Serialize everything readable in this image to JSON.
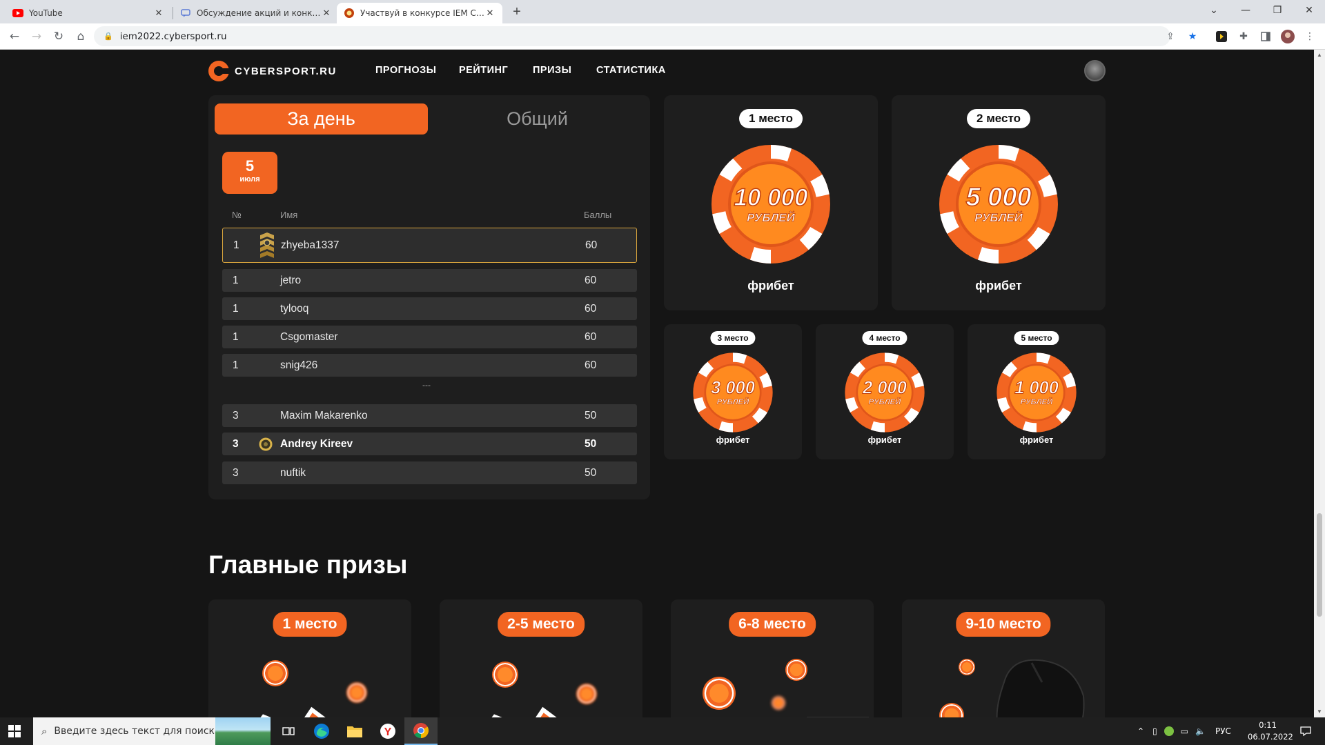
{
  "browser": {
    "tabs": [
      {
        "title": "YouTube",
        "icon": "youtube-icon"
      },
      {
        "title": "Обсуждение акций и конкурсов",
        "icon": "forum-icon"
      },
      {
        "title": "Участвуй в конкурсе IEM Cologne",
        "icon": "cybersport-icon",
        "active": true
      }
    ],
    "new_tab": "+",
    "url": "iem2022.cybersport.ru",
    "window_controls": {
      "minimize": "—",
      "restore": "❐",
      "close": "✕",
      "tabsearch": "⌄"
    }
  },
  "site": {
    "logo_text": "CYBERSPORT.RU",
    "nav": [
      "ПРОГНОЗЫ",
      "РЕЙТИНГ",
      "ПРИЗЫ",
      "СТАТИСТИКА"
    ],
    "accent_color": "#f26522"
  },
  "leaderboard": {
    "tabs": {
      "daily": "За день",
      "overall": "Общий"
    },
    "date": {
      "day": "5",
      "month": "июля"
    },
    "columns": {
      "num": "№",
      "name": "Имя",
      "points": "Баллы"
    },
    "rows": [
      {
        "num": "1",
        "name": "zhyeba1337",
        "points": "60",
        "icon": "rank-chevrons-icon"
      },
      {
        "num": "1",
        "name": "jetro",
        "points": "60"
      },
      {
        "num": "1",
        "name": "tylooq",
        "points": "60"
      },
      {
        "num": "1",
        "name": "Csgomaster",
        "points": "60"
      },
      {
        "num": "1",
        "name": "snig426",
        "points": "60"
      }
    ],
    "separator": "---",
    "rows_after": [
      {
        "num": "3",
        "name": "Maxim Makarenko",
        "points": "50"
      },
      {
        "num": "3",
        "name": "Andrey Kireev",
        "points": "50",
        "icon": "rank-ring-icon",
        "is_current_user": true
      },
      {
        "num": "3",
        "name": "nuftik",
        "points": "50"
      }
    ]
  },
  "daily_prizes": [
    {
      "place": "1 место",
      "amount": "10 000",
      "currency": "РУБЛЕЙ",
      "label": "фрибет"
    },
    {
      "place": "2 место",
      "amount": "5 000",
      "currency": "РУБЛЕЙ",
      "label": "фрибет"
    },
    {
      "place": "3 место",
      "amount": "3 000",
      "currency": "РУБЛЕЙ",
      "label": "фрибет"
    },
    {
      "place": "4 место",
      "amount": "2 000",
      "currency": "РУБЛЕЙ",
      "label": "фрибет"
    },
    {
      "place": "5 место",
      "amount": "1 000",
      "currency": "РУБЛЕЙ",
      "label": "фрибет"
    }
  ],
  "main_prizes": {
    "title": "Главные призы",
    "cards": [
      {
        "place": "1 место"
      },
      {
        "place": "2-5 место"
      },
      {
        "place": "6-8 место"
      },
      {
        "place": "9-10 место"
      }
    ]
  },
  "taskbar": {
    "search_placeholder": "Введите здесь текст для поиска",
    "apps": [
      "task-view-icon",
      "edge-icon",
      "explorer-icon",
      "yandex-icon",
      "chrome-icon"
    ],
    "language": "РУС",
    "time": "0:11",
    "date": "06.07.2022"
  }
}
